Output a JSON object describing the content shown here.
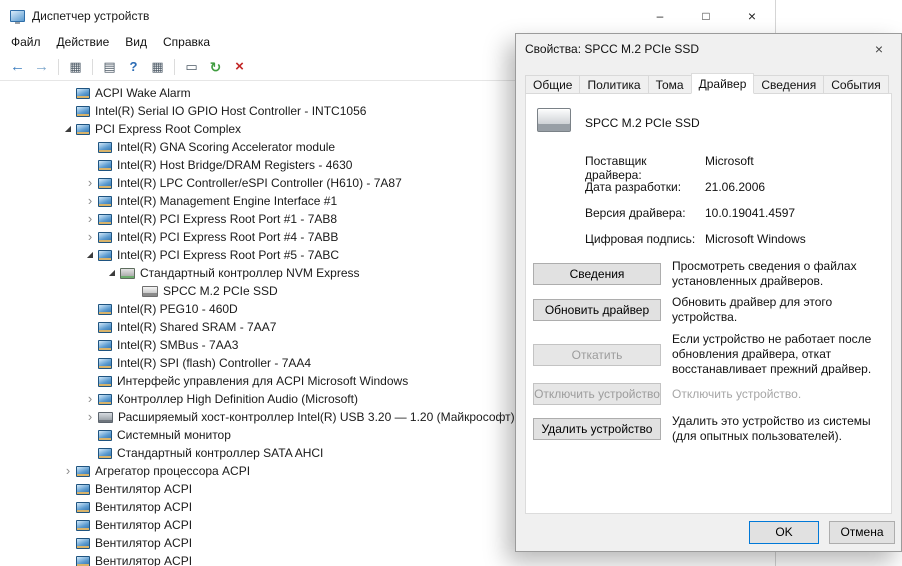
{
  "window": {
    "title": "Диспетчер устройств",
    "controls": {
      "minimize": "–",
      "maximize": "□",
      "close": "×"
    },
    "menu": [
      {
        "id": "file",
        "label": "Файл"
      },
      {
        "id": "action",
        "label": "Действие"
      },
      {
        "id": "view",
        "label": "Вид"
      },
      {
        "id": "help",
        "label": "Справка"
      }
    ]
  },
  "toolbar": [
    {
      "name": "back-button",
      "glyph": "←",
      "style": "nav"
    },
    {
      "name": "forward-button",
      "glyph": "→",
      "style": "nav-dim"
    },
    {
      "name": "separator"
    },
    {
      "name": "console-tree-button",
      "glyph": "▦",
      "style": "mono"
    },
    {
      "name": "separator"
    },
    {
      "name": "export-list-button",
      "glyph": "▤",
      "style": "mono"
    },
    {
      "name": "help-button",
      "glyph": "?",
      "style": "help"
    },
    {
      "name": "properties-button",
      "glyph": "▦",
      "style": "mono"
    },
    {
      "name": "separator"
    },
    {
      "name": "computer-button",
      "glyph": "▭",
      "style": "mono"
    },
    {
      "name": "scan-hardware-button",
      "glyph": "↻",
      "style": "scan"
    },
    {
      "name": "uninstall-device-button",
      "glyph": "×",
      "style": "danger"
    }
  ],
  "icons": {
    "collapsed": "›",
    "expanded": "◢"
  },
  "tree": {
    "items": [
      {
        "label": "ACPI Wake Alarm",
        "level": 1,
        "expander": "none",
        "icon": "chip"
      },
      {
        "label": "Intel(R) Serial IO GPIO Host Controller - INTC1056",
        "level": 1,
        "expander": "none",
        "icon": "chip"
      },
      {
        "label": "PCI Express Root Complex",
        "level": 1,
        "expander": "expanded",
        "icon": "chip"
      },
      {
        "label": "Intel(R) GNA Scoring Accelerator module",
        "level": 2,
        "expander": "none",
        "icon": "chip"
      },
      {
        "label": "Intel(R) Host Bridge/DRAM Registers - 4630",
        "level": 2,
        "expander": "none",
        "icon": "chip"
      },
      {
        "label": "Intel(R) LPC Controller/eSPI Controller (H610) - 7A87",
        "level": 2,
        "expander": "collapsed",
        "icon": "chip"
      },
      {
        "label": "Intel(R) Management Engine Interface #1",
        "level": 2,
        "expander": "collapsed",
        "icon": "chip"
      },
      {
        "label": "Intel(R) PCI Express Root Port #1 - 7AB8",
        "level": 2,
        "expander": "collapsed",
        "icon": "chip"
      },
      {
        "label": "Intel(R) PCI Express Root Port #4 - 7ABB",
        "level": 2,
        "expander": "collapsed",
        "icon": "chip"
      },
      {
        "label": "Intel(R) PCI Express Root Port #5 - 7ABC",
        "level": 2,
        "expander": "expanded",
        "icon": "chip"
      },
      {
        "label": "Стандартный контроллер NVM Express",
        "level": 3,
        "expander": "expanded",
        "icon": "nvme"
      },
      {
        "label": "SPCC M.2 PCIe SSD",
        "level": 4,
        "expander": "none",
        "icon": "disk"
      },
      {
        "label": "Intel(R) PEG10 - 460D",
        "level": 2,
        "expander": "none",
        "icon": "chip"
      },
      {
        "label": "Intel(R) Shared SRAM - 7AA7",
        "level": 2,
        "expander": "none",
        "icon": "chip"
      },
      {
        "label": "Intel(R) SMBus - 7AA3",
        "level": 2,
        "expander": "none",
        "icon": "chip"
      },
      {
        "label": "Intel(R) SPI (flash) Controller - 7AA4",
        "level": 2,
        "expander": "none",
        "icon": "chip"
      },
      {
        "label": "Интерфейс управления для ACPI Microsoft Windows",
        "level": 2,
        "expander": "none",
        "icon": "chip"
      },
      {
        "label": "Контроллер High Definition Audio (Microsoft)",
        "level": 2,
        "expander": "collapsed",
        "icon": "chip"
      },
      {
        "label": "Расширяемый хост-контроллер Intel(R) USB 3.20 — 1.20 (Майкрософт)",
        "level": 2,
        "expander": "collapsed",
        "icon": "usb"
      },
      {
        "label": "Системный монитор",
        "level": 2,
        "expander": "none",
        "icon": "chip"
      },
      {
        "label": "Стандартный контроллер SATA AHCI",
        "level": 2,
        "expander": "none",
        "icon": "chip"
      },
      {
        "label": "Агрегатор процессора ACPI",
        "level": 1,
        "expander": "collapsed",
        "icon": "chip"
      },
      {
        "label": "Вентилятор ACPI",
        "level": 1,
        "expander": "none",
        "icon": "chip"
      },
      {
        "label": "Вентилятор ACPI",
        "level": 1,
        "expander": "none",
        "icon": "chip"
      },
      {
        "label": "Вентилятор ACPI",
        "level": 1,
        "expander": "none",
        "icon": "chip"
      },
      {
        "label": "Вентилятор ACPI",
        "level": 1,
        "expander": "none",
        "icon": "chip"
      },
      {
        "label": "Вентилятор ACPI",
        "level": 1,
        "expander": "none",
        "icon": "chip"
      }
    ]
  },
  "dialog": {
    "title": "Свойства: SPCC M.2 PCIe SSD",
    "close": "×",
    "active_tab": "Драйвер",
    "tabs": [
      {
        "id": "general",
        "label": "Общие"
      },
      {
        "id": "policy",
        "label": "Политика"
      },
      {
        "id": "volumes",
        "label": "Тома"
      },
      {
        "id": "driver",
        "label": "Драйвер"
      },
      {
        "id": "details",
        "label": "Сведения"
      },
      {
        "id": "events",
        "label": "События"
      }
    ],
    "device_name": "SPCC M.2 PCIe SSD",
    "fields": [
      {
        "label": "Поставщик драйвера:",
        "value": "Microsoft"
      },
      {
        "label": "Дата разработки:",
        "value": "21.06.2006"
      },
      {
        "label": "Версия драйвера:",
        "value": "10.0.19041.4597"
      },
      {
        "label": "Цифровая подпись:",
        "value": "Microsoft Windows"
      }
    ],
    "actions": [
      {
        "id": "driver-details",
        "button": "Сведения",
        "description": "Просмотреть сведения о файлах установленных драйверов.",
        "enabled": true
      },
      {
        "id": "update-driver",
        "button": "Обновить драйвер",
        "description": "Обновить драйвер для этого устройства.",
        "enabled": true
      },
      {
        "id": "roll-back-driver",
        "button": "Откатить",
        "description": "Если устройство не работает после обновления драйвера, откат восстанавливает прежний драйвер.",
        "enabled": false
      },
      {
        "id": "disable-device",
        "button": "Отключить устройство",
        "description": "Отключить устройство.",
        "enabled": false,
        "muted_description": true
      },
      {
        "id": "uninstall-device",
        "button": "Удалить устройство",
        "description": "Удалить это устройство из системы (для опытных пользователей).",
        "enabled": true
      }
    ],
    "footer": {
      "ok": "OK",
      "cancel": "Отмена"
    }
  }
}
